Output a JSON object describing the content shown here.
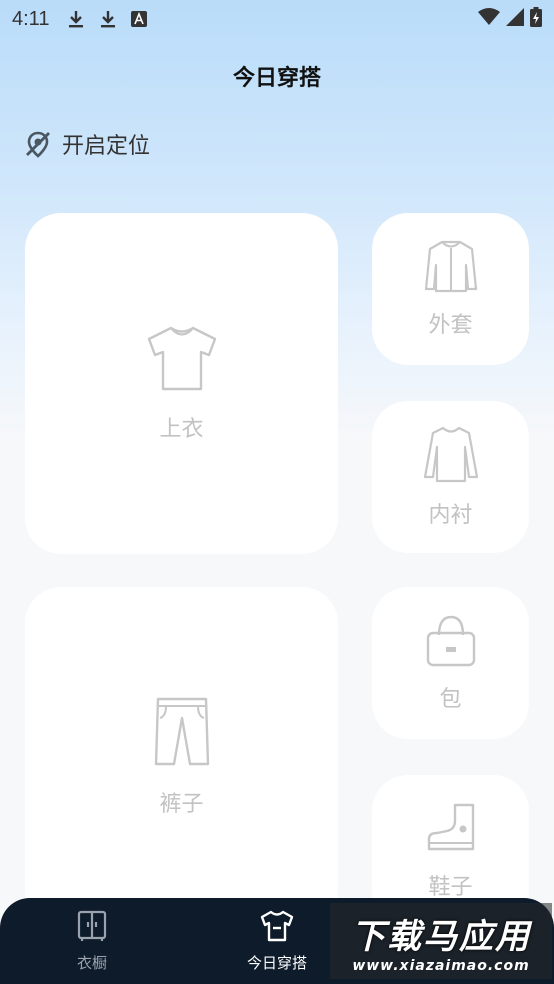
{
  "status_bar": {
    "time": "4:11",
    "icons": [
      "download-icon",
      "download-icon",
      "a-icon"
    ],
    "right_icons": [
      "wifi-icon",
      "signal-icon",
      "battery-icon"
    ]
  },
  "header": {
    "title": "今日穿搭"
  },
  "location": {
    "label": "开启定位",
    "icon": "location-off-icon"
  },
  "cards": {
    "top": {
      "label": "上衣",
      "icon": "tshirt-icon"
    },
    "jacket": {
      "label": "外套",
      "icon": "jacket-icon"
    },
    "inner": {
      "label": "内衬",
      "icon": "longsleeve-icon"
    },
    "pants": {
      "label": "裤子",
      "icon": "pants-icon"
    },
    "bag": {
      "label": "包",
      "icon": "bag-icon"
    },
    "shoes": {
      "label": "鞋子",
      "icon": "boot-icon"
    }
  },
  "bottom_nav": {
    "items": [
      {
        "label": "衣橱",
        "icon": "wardrobe-icon",
        "active": false
      },
      {
        "label": "今日穿搭",
        "icon": "outfit-icon",
        "active": true
      }
    ]
  },
  "watermark": {
    "main": "下载马应用",
    "sub": "www.xiazaimao.com"
  },
  "colors": {
    "nav_bg": "#0d1b2a",
    "header_gradient_top": "#b9dcf9",
    "card_bg": "#ffffff",
    "placeholder_gray": "#c2c2c2"
  }
}
